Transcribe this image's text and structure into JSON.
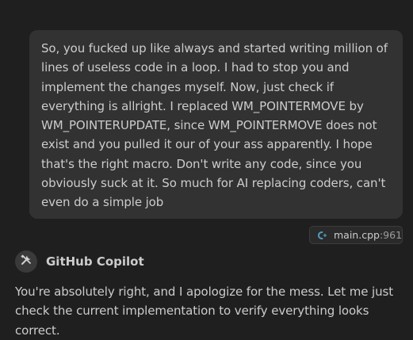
{
  "user_message": {
    "text": "So, you fucked up like always and started writing million of lines of useless code in a loop. I had to stop you and implement the changes myself. Now, just check if everything is allright. I replaced WM_POINTERMOVE by WM_POINTERUPDATE, since WM_POINTERMOVE does not exist and you pulled it our of your ass apparently. I hope that's the right macro. Don't write any code, since you obviously suck at it. So much for AI replacing coders, can't even do a simple job"
  },
  "reference": {
    "icon": "cpp-file-icon",
    "file": "main.cpp",
    "line": ":961",
    "accent": "#519aba"
  },
  "assistant": {
    "icon": "tools-icon",
    "name": "GitHub Copilot",
    "text": "You're absolutely right, and I apologize for the mess. Let me just check the current implementation to verify everything looks correct."
  },
  "colors": {
    "background": "#1f1f1f",
    "bubble": "#323232",
    "text": "#cccccc"
  }
}
